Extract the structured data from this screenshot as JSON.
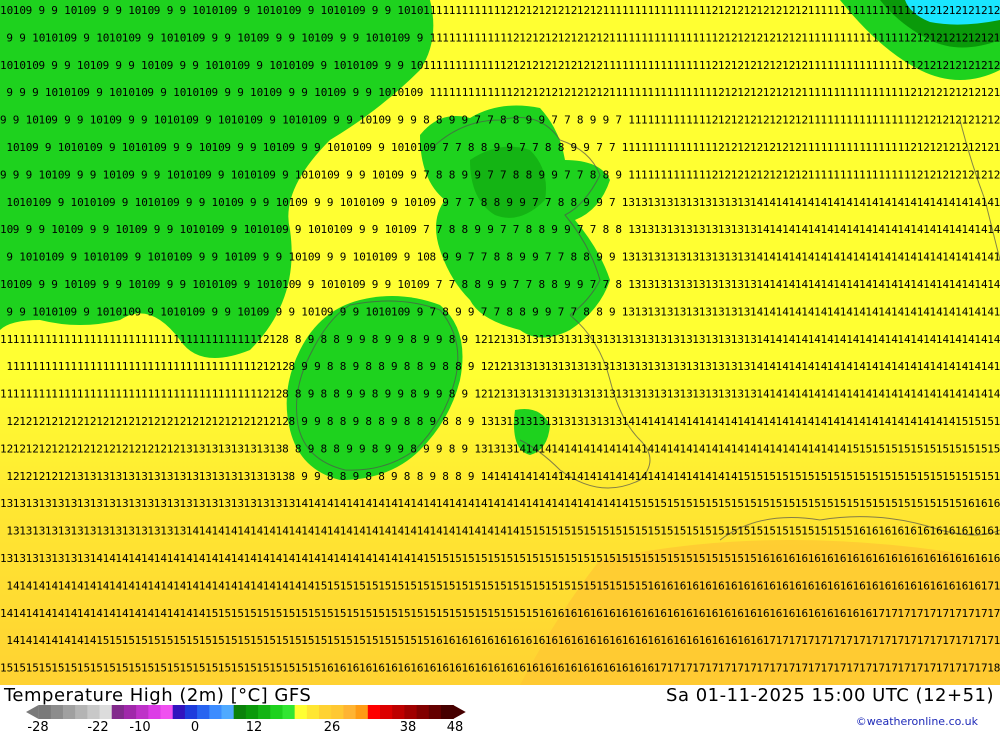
{
  "map": {
    "kind": "weather model temperature map",
    "region_shown": "British Isles, North Sea and northern France",
    "grid_values_note": "grid of temperature values; 9-11 over the Atlantic, 6-10 over Scotland and Ireland, 12-16 over the south and east",
    "colors": {
      "below_10": "#1ed21e",
      "band_10_12": "#ffff32",
      "band_12_14": "#ffe632",
      "band_14_16": "#ffc832",
      "cold_core": "#0a9a0a",
      "very_cold": "#00b400",
      "ice_patch": "#19e6ff",
      "grid_text": "#000000"
    }
  },
  "legend": {
    "title": "Temperature High (2m) [°C] GFS",
    "datetime": "Sa 01-11-2025 15:00 UTC (12+51)",
    "credit": "©weatheronline.co.uk",
    "scale_ticks": [
      "-28",
      "-22",
      "-10",
      "0",
      "12",
      "26",
      "38",
      "48"
    ],
    "scale_colors": [
      "#7a7a7a",
      "#8c8c8c",
      "#a0a0a0",
      "#b4b4b4",
      "#c8c8c8",
      "#dcdcdc",
      "#822a8c",
      "#a028aa",
      "#be32c8",
      "#dc3ce6",
      "#f050f0",
      "#3214be",
      "#1e3cdc",
      "#2864f0",
      "#3c8cff",
      "#50aaff",
      "#0a820a",
      "#0a9a0a",
      "#14b414",
      "#1ed21e",
      "#32e632",
      "#ffff32",
      "#ffe632",
      "#ffd232",
      "#ffc832",
      "#ffb432",
      "#ff9b14",
      "#ff0000",
      "#dc0000",
      "#be0000",
      "#a00000",
      "#820000",
      "#640000",
      "#460000"
    ]
  }
}
